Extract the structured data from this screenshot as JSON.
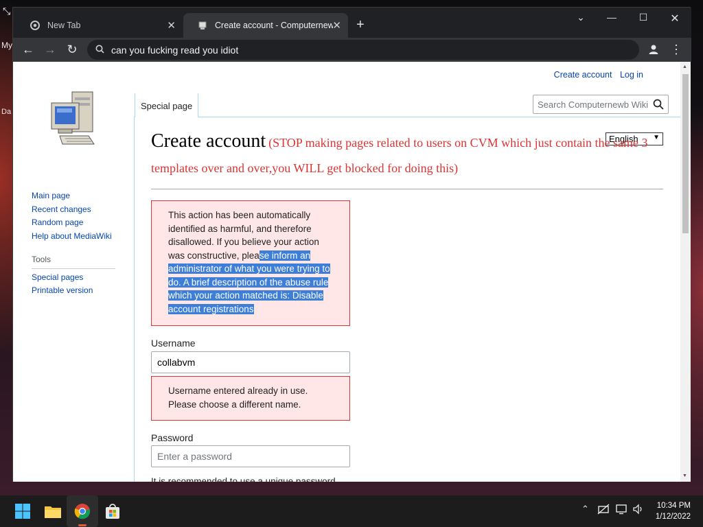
{
  "desktop": {
    "labels": [
      "My",
      "Da"
    ]
  },
  "browser": {
    "tabs": [
      {
        "title": "New Tab",
        "icon": "chrome-icon"
      },
      {
        "title": "Create account - Computernewb",
        "icon": "wiki-favicon"
      }
    ],
    "address": "can you fucking read you idiot"
  },
  "page": {
    "personal": {
      "create_account": "Create account",
      "log_in": "Log in"
    },
    "namespace_tab": "Special page",
    "search_placeholder": "Search Computernewb Wiki",
    "language": "English",
    "heading": {
      "title": "Create account",
      "note": "(STOP making pages related to users on CVM which just contain the same 3 templates over and over,you WILL get blocked for doing this)"
    },
    "sidebar": {
      "nav": [
        "Main page",
        "Recent changes",
        "Random page",
        "Help about MediaWiki"
      ],
      "tools_heading": "Tools",
      "tools": [
        "Special pages",
        "Printable version"
      ]
    },
    "abuse_error": {
      "plain": "This action has been automatically identified as harmful, and therefore disallowed. If you believe your action was constructive, plea",
      "selected": "se inform an administrator of what you were trying to do. A brief description of the abuse rule which your action matched is: Disable account registrations"
    },
    "username": {
      "label": "Username",
      "value": "collabvm"
    },
    "username_error": "Username entered already in use. Please choose a different name.",
    "password": {
      "label": "Password",
      "placeholder": "Enter a password"
    },
    "password_hint": "It is recommended to use a unique password"
  },
  "taskbar": {
    "time": "10:34 PM",
    "date": "1/12/2022"
  },
  "colors": {
    "link": "#0645ad",
    "error_border": "#d33",
    "error_bg": "#fee7e6",
    "selection": "#3d7ed8"
  }
}
